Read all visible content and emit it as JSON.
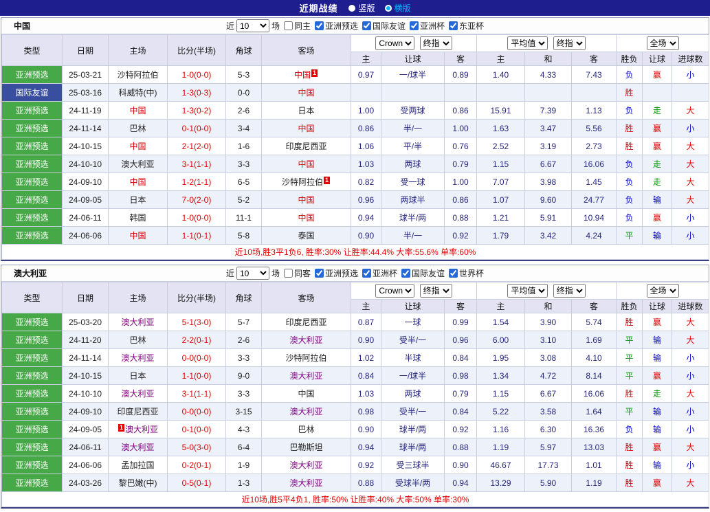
{
  "topbar": {
    "title": "近期战绩",
    "vertical_label": "竖版",
    "horizontal_label": "横版",
    "selected_layout": "横版"
  },
  "labels": {
    "near": "近",
    "games": "场"
  },
  "table_header": {
    "cols": [
      "类型",
      "日期",
      "主场",
      "比分(半场)",
      "角球",
      "客场"
    ],
    "bookmaker": "Crown",
    "final_odds": "终指",
    "average": "平均值",
    "full_match": "全场",
    "sub": [
      "主",
      "让球",
      "客",
      "主",
      "和",
      "客",
      "胜负",
      "让球",
      "进球数"
    ]
  },
  "colors": {
    "topbar": "#1e1e8f",
    "cyan": "#00b4ff",
    "header_bg": "#e3e3f3",
    "row_alt": "#edf1fa",
    "green_type": "#46a846",
    "blue_type": "#3a4ea0",
    "red": "#e30000",
    "result_green": "#009900",
    "result_blue": "#0000cc",
    "odds_navy": "#26267e"
  },
  "sections": [
    {
      "team": "中国",
      "focus_color": "#d40000",
      "filter": {
        "count": "10",
        "checkboxes": [
          {
            "label": "同主",
            "checked": false
          },
          {
            "label": "亚洲预选",
            "checked": true
          },
          {
            "label": "国际友谊",
            "checked": true
          },
          {
            "label": "亚洲杯",
            "checked": true
          },
          {
            "label": "东亚杯",
            "checked": true
          }
        ]
      },
      "rows": [
        {
          "type": "亚洲预选",
          "type_key": "asian",
          "date": "25-03-21",
          "home": {
            "name": "沙特阿拉伯",
            "focus": false,
            "badge": ""
          },
          "score": "1-0(0-0)",
          "corner": "5-3",
          "away": {
            "name": "中国",
            "focus": true,
            "badge": "1",
            "badge_side": "right"
          },
          "odds": [
            "0.97",
            "一/球半",
            "0.89"
          ],
          "avg": [
            "1.40",
            "4.33",
            "7.43"
          ],
          "result": [
            {
              "t": "负",
              "c": "b"
            },
            {
              "t": "赢",
              "c": "r"
            },
            {
              "t": "小",
              "c": "b"
            }
          ]
        },
        {
          "type": "国际友谊",
          "type_key": "friendly",
          "date": "25-03-16",
          "home": {
            "name": "科威特(中)",
            "focus": false,
            "badge": ""
          },
          "score": "1-3(0-3)",
          "corner": "0-0",
          "away": {
            "name": "中国",
            "focus": true,
            "badge": ""
          },
          "odds": [
            "",
            "",
            ""
          ],
          "avg": [
            "",
            "",
            ""
          ],
          "result": [
            {
              "t": "胜",
              "c": "r"
            },
            {
              "t": "",
              "c": "n"
            },
            {
              "t": "",
              "c": "n"
            }
          ]
        },
        {
          "type": "亚洲预选",
          "type_key": "asian",
          "date": "24-11-19",
          "home": {
            "name": "中国",
            "focus": true,
            "badge": ""
          },
          "score": "1-3(0-2)",
          "corner": "2-6",
          "away": {
            "name": "日本",
            "focus": false,
            "badge": ""
          },
          "odds": [
            "1.00",
            "受两球",
            "0.86"
          ],
          "avg": [
            "15.91",
            "7.39",
            "1.13"
          ],
          "result": [
            {
              "t": "负",
              "c": "b"
            },
            {
              "t": "走",
              "c": "g"
            },
            {
              "t": "大",
              "c": "r"
            }
          ]
        },
        {
          "type": "亚洲预选",
          "type_key": "asian",
          "date": "24-11-14",
          "home": {
            "name": "巴林",
            "focus": false,
            "badge": ""
          },
          "score": "0-1(0-0)",
          "corner": "3-4",
          "away": {
            "name": "中国",
            "focus": true,
            "badge": ""
          },
          "odds": [
            "0.86",
            "半/一",
            "1.00"
          ],
          "avg": [
            "1.63",
            "3.47",
            "5.56"
          ],
          "result": [
            {
              "t": "胜",
              "c": "r"
            },
            {
              "t": "赢",
              "c": "r"
            },
            {
              "t": "小",
              "c": "b"
            }
          ]
        },
        {
          "type": "亚洲预选",
          "type_key": "asian",
          "date": "24-10-15",
          "home": {
            "name": "中国",
            "focus": true,
            "badge": ""
          },
          "score": "2-1(2-0)",
          "corner": "1-6",
          "away": {
            "name": "印度尼西亚",
            "focus": false,
            "badge": ""
          },
          "odds": [
            "1.06",
            "平/半",
            "0.76"
          ],
          "avg": [
            "2.52",
            "3.19",
            "2.73"
          ],
          "result": [
            {
              "t": "胜",
              "c": "r"
            },
            {
              "t": "赢",
              "c": "r"
            },
            {
              "t": "大",
              "c": "r"
            }
          ]
        },
        {
          "type": "亚洲预选",
          "type_key": "asian",
          "date": "24-10-10",
          "home": {
            "name": "澳大利亚",
            "focus": false,
            "badge": ""
          },
          "score": "3-1(1-1)",
          "corner": "3-3",
          "away": {
            "name": "中国",
            "focus": true,
            "badge": ""
          },
          "odds": [
            "1.03",
            "两球",
            "0.79"
          ],
          "avg": [
            "1.15",
            "6.67",
            "16.06"
          ],
          "result": [
            {
              "t": "负",
              "c": "b"
            },
            {
              "t": "走",
              "c": "g"
            },
            {
              "t": "大",
              "c": "r"
            }
          ]
        },
        {
          "type": "亚洲预选",
          "type_key": "asian",
          "date": "24-09-10",
          "home": {
            "name": "中国",
            "focus": true,
            "badge": ""
          },
          "score": "1-2(1-1)",
          "corner": "6-5",
          "away": {
            "name": "沙特阿拉伯",
            "focus": false,
            "badge": "1",
            "badge_side": "right"
          },
          "odds": [
            "0.82",
            "受一球",
            "1.00"
          ],
          "avg": [
            "7.07",
            "3.98",
            "1.45"
          ],
          "result": [
            {
              "t": "负",
              "c": "b"
            },
            {
              "t": "走",
              "c": "g"
            },
            {
              "t": "大",
              "c": "r"
            }
          ]
        },
        {
          "type": "亚洲预选",
          "type_key": "asian",
          "date": "24-09-05",
          "home": {
            "name": "日本",
            "focus": false,
            "badge": ""
          },
          "score": "7-0(2-0)",
          "corner": "5-2",
          "away": {
            "name": "中国",
            "focus": true,
            "badge": ""
          },
          "odds": [
            "0.96",
            "两球半",
            "0.86"
          ],
          "avg": [
            "1.07",
            "9.60",
            "24.77"
          ],
          "result": [
            {
              "t": "负",
              "c": "b"
            },
            {
              "t": "输",
              "c": "b"
            },
            {
              "t": "大",
              "c": "r"
            }
          ]
        },
        {
          "type": "亚洲预选",
          "type_key": "asian",
          "date": "24-06-11",
          "home": {
            "name": "韩国",
            "focus": false,
            "badge": ""
          },
          "score": "1-0(0-0)",
          "corner": "11-1",
          "away": {
            "name": "中国",
            "focus": true,
            "badge": ""
          },
          "odds": [
            "0.94",
            "球半/两",
            "0.88"
          ],
          "avg": [
            "1.21",
            "5.91",
            "10.94"
          ],
          "result": [
            {
              "t": "负",
              "c": "b"
            },
            {
              "t": "赢",
              "c": "r"
            },
            {
              "t": "小",
              "c": "b"
            }
          ]
        },
        {
          "type": "亚洲预选",
          "type_key": "asian",
          "date": "24-06-06",
          "home": {
            "name": "中国",
            "focus": true,
            "badge": ""
          },
          "score": "1-1(0-1)",
          "corner": "5-8",
          "away": {
            "name": "泰国",
            "focus": false,
            "badge": ""
          },
          "odds": [
            "0.90",
            "半/一",
            "0.92"
          ],
          "avg": [
            "1.79",
            "3.42",
            "4.24"
          ],
          "result": [
            {
              "t": "平",
              "c": "g"
            },
            {
              "t": "输",
              "c": "b"
            },
            {
              "t": "小",
              "c": "b"
            }
          ]
        }
      ],
      "summary": "近10场,胜3平1负6, 胜率:30% 让胜率:44.4% 大率:55.6% 单率:60%"
    },
    {
      "team": "澳大利亚",
      "focus_color": "#800080",
      "filter": {
        "count": "10",
        "checkboxes": [
          {
            "label": "同客",
            "checked": false
          },
          {
            "label": "亚洲预选",
            "checked": true
          },
          {
            "label": "亚洲杯",
            "checked": true
          },
          {
            "label": "国际友谊",
            "checked": true
          },
          {
            "label": "世界杯",
            "checked": true
          }
        ]
      },
      "rows": [
        {
          "type": "亚洲预选",
          "type_key": "asian",
          "date": "25-03-20",
          "home": {
            "name": "澳大利亚",
            "focus": true,
            "badge": ""
          },
          "score": "5-1(3-0)",
          "corner": "5-7",
          "away": {
            "name": "印度尼西亚",
            "focus": false,
            "badge": ""
          },
          "odds": [
            "0.87",
            "一球",
            "0.99"
          ],
          "avg": [
            "1.54",
            "3.90",
            "5.74"
          ],
          "result": [
            {
              "t": "胜",
              "c": "r"
            },
            {
              "t": "赢",
              "c": "r"
            },
            {
              "t": "大",
              "c": "r"
            }
          ]
        },
        {
          "type": "亚洲预选",
          "type_key": "asian",
          "date": "24-11-20",
          "home": {
            "name": "巴林",
            "focus": false,
            "badge": ""
          },
          "score": "2-2(0-1)",
          "corner": "2-6",
          "away": {
            "name": "澳大利亚",
            "focus": true,
            "badge": ""
          },
          "odds": [
            "0.90",
            "受半/一",
            "0.96"
          ],
          "avg": [
            "6.00",
            "3.10",
            "1.69"
          ],
          "result": [
            {
              "t": "平",
              "c": "g"
            },
            {
              "t": "输",
              "c": "b"
            },
            {
              "t": "大",
              "c": "r"
            }
          ]
        },
        {
          "type": "亚洲预选",
          "type_key": "asian",
          "date": "24-11-14",
          "home": {
            "name": "澳大利亚",
            "focus": true,
            "badge": ""
          },
          "score": "0-0(0-0)",
          "corner": "3-3",
          "away": {
            "name": "沙特阿拉伯",
            "focus": false,
            "badge": ""
          },
          "odds": [
            "1.02",
            "半球",
            "0.84"
          ],
          "avg": [
            "1.95",
            "3.08",
            "4.10"
          ],
          "result": [
            {
              "t": "平",
              "c": "g"
            },
            {
              "t": "输",
              "c": "b"
            },
            {
              "t": "小",
              "c": "b"
            }
          ]
        },
        {
          "type": "亚洲预选",
          "type_key": "asian",
          "date": "24-10-15",
          "home": {
            "name": "日本",
            "focus": false,
            "badge": ""
          },
          "score": "1-1(0-0)",
          "corner": "9-0",
          "away": {
            "name": "澳大利亚",
            "focus": true,
            "badge": ""
          },
          "odds": [
            "0.84",
            "一/球半",
            "0.98"
          ],
          "avg": [
            "1.34",
            "4.72",
            "8.14"
          ],
          "result": [
            {
              "t": "平",
              "c": "g"
            },
            {
              "t": "赢",
              "c": "r"
            },
            {
              "t": "小",
              "c": "b"
            }
          ]
        },
        {
          "type": "亚洲预选",
          "type_key": "asian",
          "date": "24-10-10",
          "home": {
            "name": "澳大利亚",
            "focus": true,
            "badge": ""
          },
          "score": "3-1(1-1)",
          "corner": "3-3",
          "away": {
            "name": "中国",
            "focus": false,
            "badge": ""
          },
          "odds": [
            "1.03",
            "两球",
            "0.79"
          ],
          "avg": [
            "1.15",
            "6.67",
            "16.06"
          ],
          "result": [
            {
              "t": "胜",
              "c": "r"
            },
            {
              "t": "走",
              "c": "g"
            },
            {
              "t": "大",
              "c": "r"
            }
          ]
        },
        {
          "type": "亚洲预选",
          "type_key": "asian",
          "date": "24-09-10",
          "home": {
            "name": "印度尼西亚",
            "focus": false,
            "badge": ""
          },
          "score": "0-0(0-0)",
          "corner": "3-15",
          "away": {
            "name": "澳大利亚",
            "focus": true,
            "badge": ""
          },
          "odds": [
            "0.98",
            "受半/一",
            "0.84"
          ],
          "avg": [
            "5.22",
            "3.58",
            "1.64"
          ],
          "result": [
            {
              "t": "平",
              "c": "g"
            },
            {
              "t": "输",
              "c": "b"
            },
            {
              "t": "小",
              "c": "b"
            }
          ]
        },
        {
          "type": "亚洲预选",
          "type_key": "asian",
          "date": "24-09-05",
          "home": {
            "name": "澳大利亚",
            "focus": true,
            "badge": "1",
            "badge_side": "left"
          },
          "score": "0-1(0-0)",
          "corner": "4-3",
          "away": {
            "name": "巴林",
            "focus": false,
            "badge": ""
          },
          "odds": [
            "0.90",
            "球半/两",
            "0.92"
          ],
          "avg": [
            "1.16",
            "6.30",
            "16.36"
          ],
          "result": [
            {
              "t": "负",
              "c": "b"
            },
            {
              "t": "输",
              "c": "b"
            },
            {
              "t": "小",
              "c": "b"
            }
          ]
        },
        {
          "type": "亚洲预选",
          "type_key": "asian",
          "date": "24-06-11",
          "home": {
            "name": "澳大利亚",
            "focus": true,
            "badge": ""
          },
          "score": "5-0(3-0)",
          "corner": "6-4",
          "away": {
            "name": "巴勒斯坦",
            "focus": false,
            "badge": ""
          },
          "odds": [
            "0.94",
            "球半/两",
            "0.88"
          ],
          "avg": [
            "1.19",
            "5.97",
            "13.03"
          ],
          "result": [
            {
              "t": "胜",
              "c": "r"
            },
            {
              "t": "赢",
              "c": "r"
            },
            {
              "t": "大",
              "c": "r"
            }
          ]
        },
        {
          "type": "亚洲预选",
          "type_key": "asian",
          "date": "24-06-06",
          "home": {
            "name": "孟加拉国",
            "focus": false,
            "badge": ""
          },
          "score": "0-2(0-1)",
          "corner": "1-9",
          "away": {
            "name": "澳大利亚",
            "focus": true,
            "badge": ""
          },
          "odds": [
            "0.92",
            "受三球半",
            "0.90"
          ],
          "avg": [
            "46.67",
            "17.73",
            "1.01"
          ],
          "result": [
            {
              "t": "胜",
              "c": "r"
            },
            {
              "t": "输",
              "c": "b"
            },
            {
              "t": "小",
              "c": "b"
            }
          ]
        },
        {
          "type": "亚洲预选",
          "type_key": "asian",
          "date": "24-03-26",
          "home": {
            "name": "黎巴嫩(中)",
            "focus": false,
            "badge": ""
          },
          "score": "0-5(0-1)",
          "corner": "1-3",
          "away": {
            "name": "澳大利亚",
            "focus": true,
            "badge": ""
          },
          "odds": [
            "0.88",
            "受球半/两",
            "0.94"
          ],
          "avg": [
            "13.29",
            "5.90",
            "1.19"
          ],
          "result": [
            {
              "t": "胜",
              "c": "r"
            },
            {
              "t": "赢",
              "c": "r"
            },
            {
              "t": "大",
              "c": "r"
            }
          ]
        }
      ],
      "summary": "近10场,胜5平4负1, 胜率:50% 让胜率:40% 大率:50% 单率:30%"
    }
  ]
}
